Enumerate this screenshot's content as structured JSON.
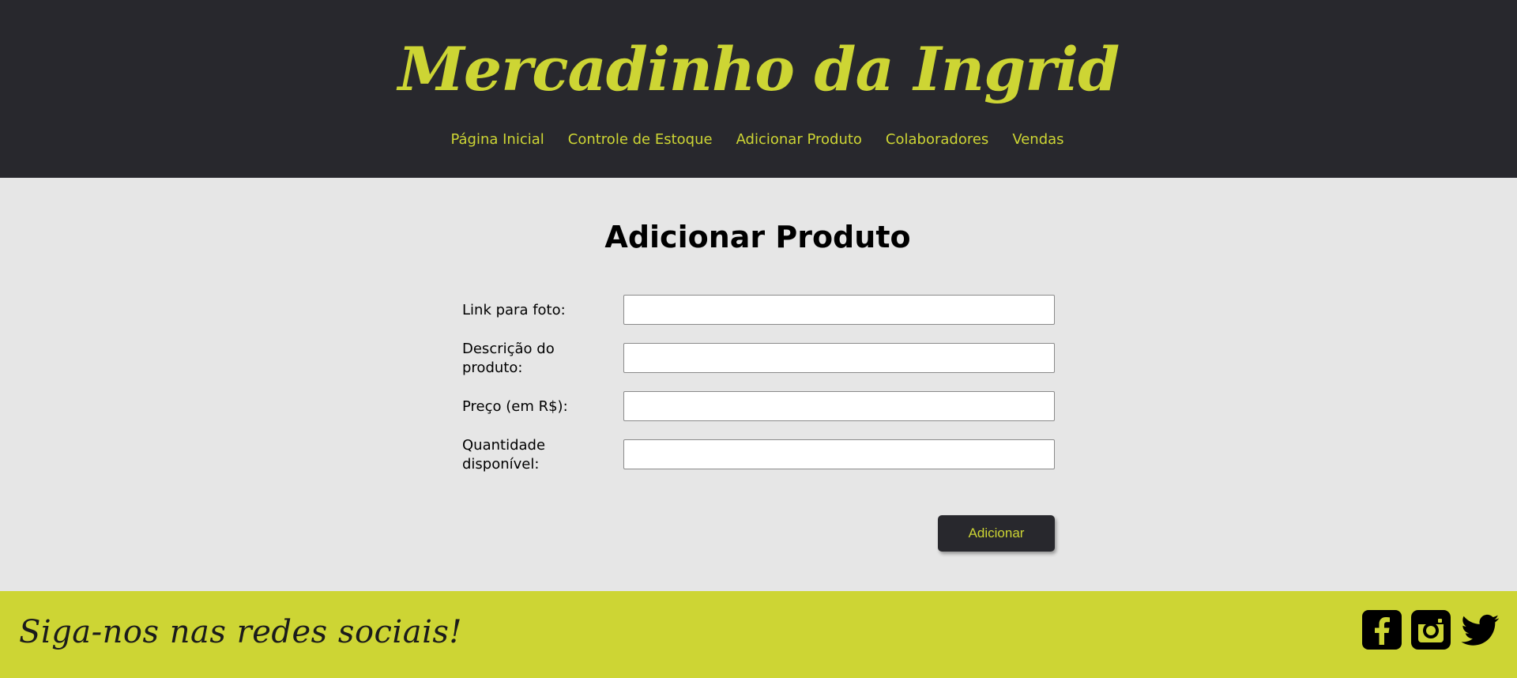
{
  "header": {
    "brand": "Mercadinho da Ingrid",
    "nav": [
      {
        "label": "Página Inicial"
      },
      {
        "label": "Controle de Estoque"
      },
      {
        "label": "Adicionar Produto"
      },
      {
        "label": "Colaboradores"
      },
      {
        "label": "Vendas"
      }
    ]
  },
  "main": {
    "title": "Adicionar Produto",
    "fields": [
      {
        "label": "Link para foto:",
        "value": ""
      },
      {
        "label": "Descrição do produto:",
        "value": ""
      },
      {
        "label": "Preço (em R$):",
        "value": ""
      },
      {
        "label": "Quantidade disponível:",
        "value": ""
      }
    ],
    "submit_label": "Adicionar"
  },
  "footer": {
    "text": "Siga-nos nas redes sociais!",
    "socials": [
      {
        "icon": "facebook-icon"
      },
      {
        "icon": "instagram-icon"
      },
      {
        "icon": "twitter-icon"
      }
    ]
  },
  "colors": {
    "header_bg": "#28282d",
    "accent": "#cdd534",
    "main_bg": "#e6e6e6"
  }
}
